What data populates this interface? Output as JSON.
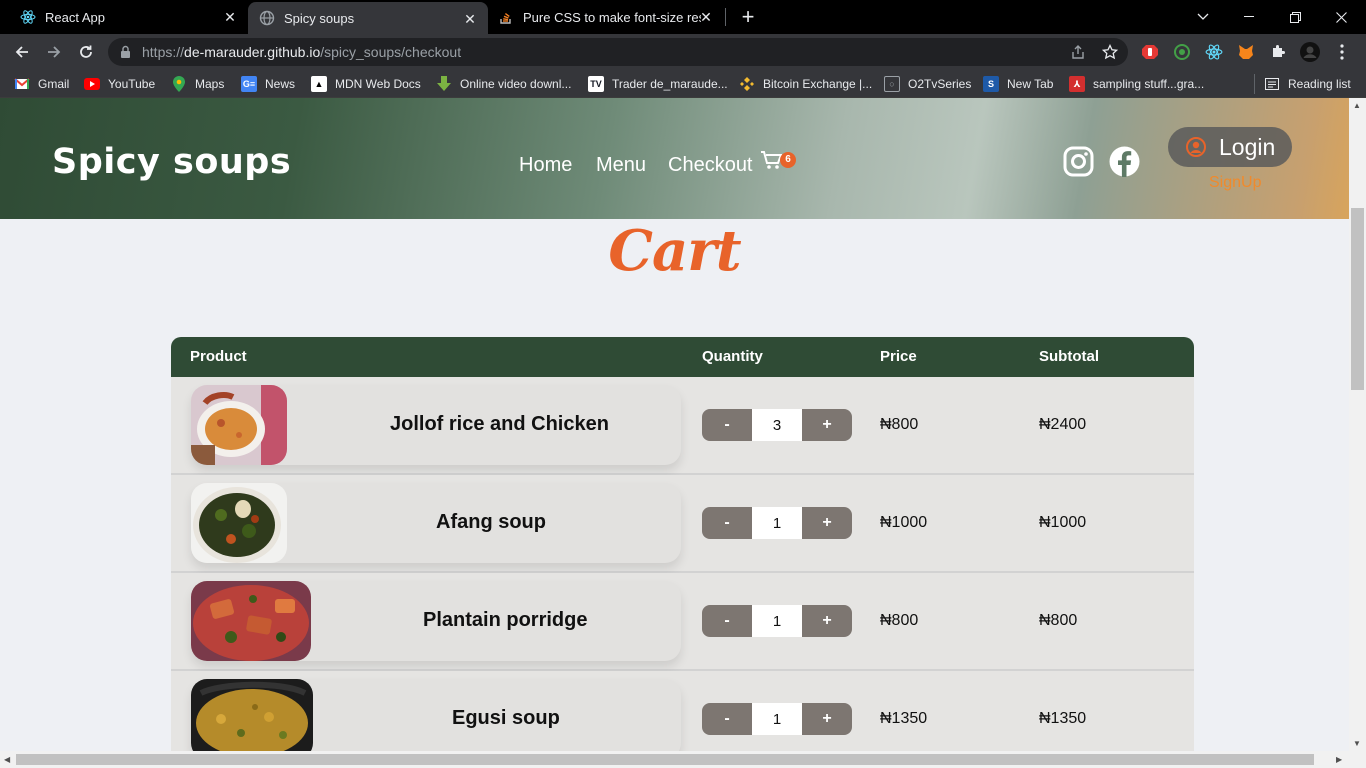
{
  "browser": {
    "tabs": [
      {
        "title": "React App",
        "icon": "react-icon"
      },
      {
        "title": "Spicy soups",
        "icon": "globe-icon"
      },
      {
        "title": "Pure CSS to make font-size respo",
        "icon": "stackoverflow-icon"
      }
    ],
    "url_scheme": "https://",
    "url_host": "de-marauder.github.io",
    "url_path": "/spicy_soups/checkout",
    "bookmarks": [
      {
        "label": "Gmail",
        "icon": "gmail-icon",
        "color": "#ea4335"
      },
      {
        "label": "YouTube",
        "icon": "youtube-icon",
        "color": "#ff0000"
      },
      {
        "label": "Maps",
        "icon": "maps-icon",
        "color": "#34a853"
      },
      {
        "label": "News",
        "icon": "news-icon",
        "color": "#4285f4"
      },
      {
        "label": "MDN Web Docs",
        "icon": "mdn-icon",
        "color": "#000000"
      },
      {
        "label": "Online video downl...",
        "icon": "download-icon",
        "color": "#7cb342"
      },
      {
        "label": "Trader de_maraude...",
        "icon": "tradingview-icon",
        "color": "#131722"
      },
      {
        "label": "Bitcoin Exchange |...",
        "icon": "binance-icon",
        "color": "#f3ba2f"
      },
      {
        "label": "O2TvSeries",
        "icon": "o2tv-icon",
        "color": "#5f6368"
      },
      {
        "label": "New Tab",
        "icon": "newtab-icon",
        "color": "#1e5aa8"
      },
      {
        "label": "sampling stuff...gra...",
        "icon": "pdf-icon",
        "color": "#d32f2f"
      }
    ],
    "reading_list": "Reading list"
  },
  "site": {
    "brand": "Spicy soups",
    "nav": {
      "home": "Home",
      "menu": "Menu",
      "checkout": "Checkout"
    },
    "cart_count": "6",
    "login": "Login",
    "signup": "SignUp",
    "accent_color": "#e8632a",
    "header_color": "#2f4b35"
  },
  "cart": {
    "title": "Cart",
    "columns": {
      "product": "Product",
      "quantity": "Quantity",
      "price": "Price",
      "subtotal": "Subtotal"
    },
    "minus_label": "-",
    "plus_label": "+",
    "items": [
      {
        "name": "Jollof rice and Chicken",
        "qty": "3",
        "price": "₦800",
        "subtotal": "₦2400"
      },
      {
        "name": "Afang soup",
        "qty": "1",
        "price": "₦1000",
        "subtotal": "₦1000"
      },
      {
        "name": "Plantain porridge",
        "qty": "1",
        "price": "₦800",
        "subtotal": "₦800"
      },
      {
        "name": "Egusi soup",
        "qty": "1",
        "price": "₦1350",
        "subtotal": "₦1350"
      }
    ]
  }
}
